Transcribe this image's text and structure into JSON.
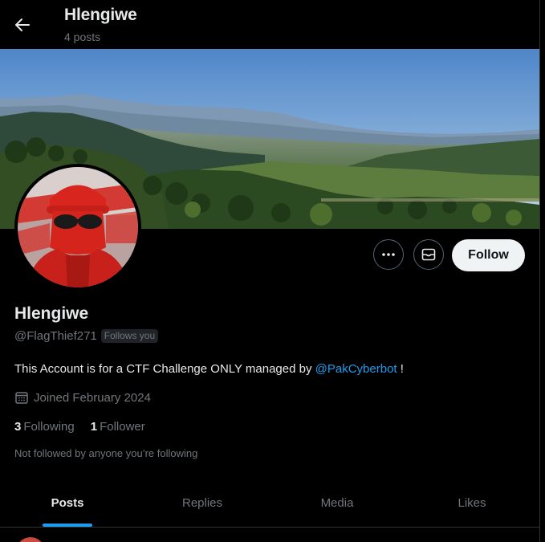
{
  "header": {
    "back_icon": "arrow-left-icon",
    "name": "Hlengiwe",
    "posts_count": "4 posts"
  },
  "profile": {
    "display_name": "Hlengiwe",
    "handle": "@FlagThief271",
    "follows_you_badge": "Follows you",
    "bio_prefix": "This Account is for a CTF Challenge ONLY managed by ",
    "bio_mention": "@PakCyberbot",
    "bio_suffix": " !",
    "joined": "Joined February 2024",
    "following_count": "3",
    "following_label": "Following",
    "followers_count": "1",
    "followers_label": "Follower",
    "not_followed_text": "Not followed by anyone you’re following"
  },
  "actions": {
    "more_icon": "more-horizontal-icon",
    "message_icon": "envelope-icon",
    "follow_label": "Follow"
  },
  "tabs": [
    {
      "label": "Posts",
      "active": true
    },
    {
      "label": "Replies",
      "active": false
    },
    {
      "label": "Media",
      "active": false
    },
    {
      "label": "Likes",
      "active": false
    }
  ],
  "colors": {
    "background": "#000000",
    "accent": "#1d9bf0",
    "secondary_text": "#71767b",
    "primary_text": "#e7e9ea",
    "follow_button_bg": "#eff3f4"
  }
}
